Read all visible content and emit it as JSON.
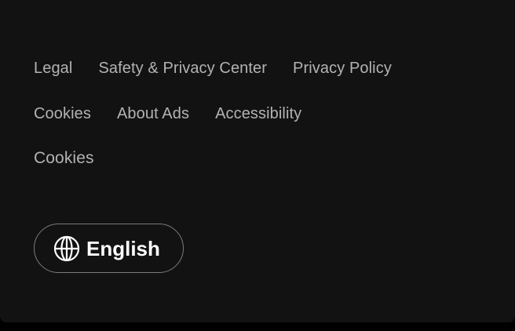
{
  "footer": {
    "links_row1": [
      "Legal",
      "Safety & Privacy Center",
      "Privacy Policy"
    ],
    "links_row2": [
      "Cookies",
      "About Ads",
      "Accessibility"
    ],
    "links_row3": [
      "Cookies"
    ]
  },
  "language": {
    "label": "English",
    "icon": "globe-icon"
  },
  "colors": {
    "panel_background": "#121212",
    "link_text": "#b3b3b3",
    "button_border": "#7c7c7c",
    "button_text": "#ffffff"
  }
}
